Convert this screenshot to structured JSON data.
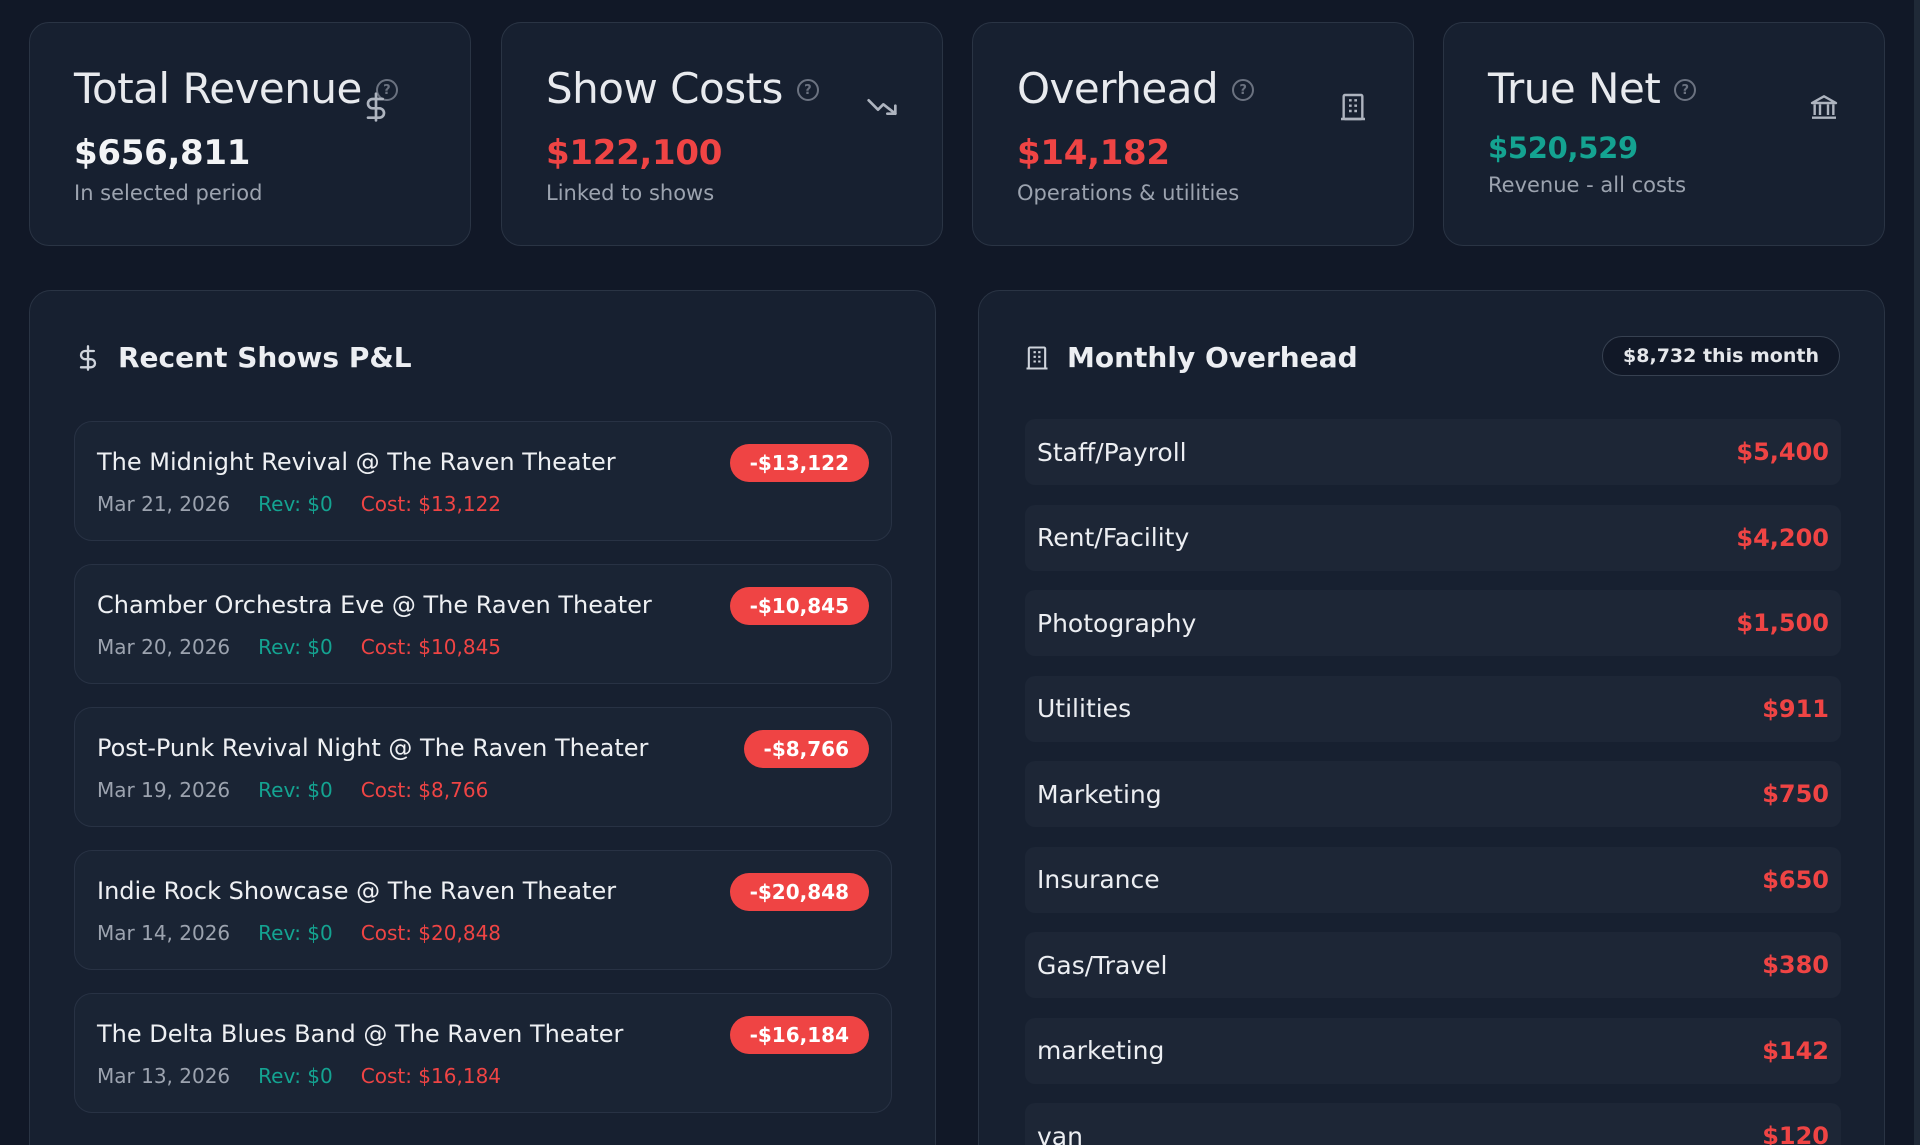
{
  "stats": [
    {
      "title": "Total Revenue",
      "value": "$656,811",
      "sub": "In selected period",
      "icon": "dollar-icon",
      "tone": "white"
    },
    {
      "title": "Show Costs",
      "value": "$122,100",
      "sub": "Linked to shows",
      "icon": "trending-down-icon",
      "tone": "red"
    },
    {
      "title": "Overhead",
      "value": "$14,182",
      "sub": "Operations & utilities",
      "icon": "building-icon",
      "tone": "red"
    },
    {
      "title": "True Net",
      "value": "$520,529",
      "sub": "Revenue - all costs",
      "icon": "bank-icon",
      "tone": "teal"
    }
  ],
  "recent_shows": {
    "title": "Recent Shows P&L",
    "items": [
      {
        "title": "The Midnight Revival @ The Raven Theater",
        "date": "Mar 21, 2026",
        "rev": "Rev: $0",
        "cost": "Cost: $13,122",
        "net": "-$13,122"
      },
      {
        "title": "Chamber Orchestra Eve @ The Raven Theater",
        "date": "Mar 20, 2026",
        "rev": "Rev: $0",
        "cost": "Cost: $10,845",
        "net": "-$10,845"
      },
      {
        "title": "Post-Punk Revival Night @ The Raven Theater",
        "date": "Mar 19, 2026",
        "rev": "Rev: $0",
        "cost": "Cost: $8,766",
        "net": "-$8,766"
      },
      {
        "title": "Indie Rock Showcase @ The Raven Theater",
        "date": "Mar 14, 2026",
        "rev": "Rev: $0",
        "cost": "Cost: $20,848",
        "net": "-$20,848"
      },
      {
        "title": "The Delta Blues Band @ The Raven Theater",
        "date": "Mar 13, 2026",
        "rev": "Rev: $0",
        "cost": "Cost: $16,184",
        "net": "-$16,184"
      }
    ]
  },
  "monthly_overhead": {
    "title": "Monthly Overhead",
    "badge": "$8,732 this month",
    "items": [
      {
        "name": "Staff/Payroll",
        "amount": "$5,400"
      },
      {
        "name": "Rent/Facility",
        "amount": "$4,200"
      },
      {
        "name": "Photography",
        "amount": "$1,500"
      },
      {
        "name": "Utilities",
        "amount": "$911"
      },
      {
        "name": "Marketing",
        "amount": "$750"
      },
      {
        "name": "Insurance",
        "amount": "$650"
      },
      {
        "name": "Gas/Travel",
        "amount": "$380"
      },
      {
        "name": "marketing",
        "amount": "$142"
      },
      {
        "name": "van",
        "amount": "$120"
      }
    ]
  },
  "colors": {
    "accent_red": "#ef4444",
    "accent_teal": "#14a391",
    "background": "#111827",
    "card": "#172030"
  }
}
